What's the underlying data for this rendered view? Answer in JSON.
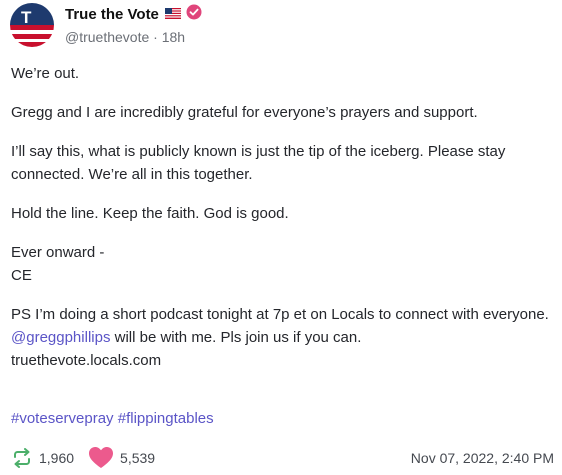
{
  "author": {
    "display_name": "True the Vote",
    "handle": "@truethevote",
    "separator": "·",
    "time_ago": "18h",
    "avatar_letter": "T",
    "flag_icon": "us-flag-icon",
    "verified_icon": "verified-badge-icon"
  },
  "body": {
    "p1": "We’re out.",
    "p2": "Gregg and I are incredibly grateful for everyone’s prayers and support.",
    "p3": "I’ll say this, what is publicly known is just the tip of the iceberg. Please stay connected. We’re all in this together.",
    "p4": "Hold the line. Keep the faith. God is good.",
    "p5_line1": "Ever onward -",
    "p5_line2": "CE",
    "p6_before": "PS I’m doing a short podcast tonight at 7p et on Locals to connect with everyone.",
    "p6_mention": "@greggphillips",
    "p6_after": "will be with me. Pls join us if you can.",
    "p6_url": "truethevote.locals.com"
  },
  "hashtags": {
    "tag1": "#voteservepray",
    "tag2": "#flippingtables"
  },
  "footer": {
    "retruths_count": "1,960",
    "likes_count": "5,539",
    "timestamp": "Nov 07, 2022, 2:40 PM",
    "retruth_icon": "repost-icon",
    "like_icon": "heart-icon"
  },
  "colors": {
    "link": "#5b55c7",
    "retruth_green": "#4caf6a",
    "heart_pink": "#ec5a8d",
    "verified_pink": "#e0457b",
    "avatar_red": "#c8102e",
    "avatar_navy": "#1e3a6e"
  }
}
